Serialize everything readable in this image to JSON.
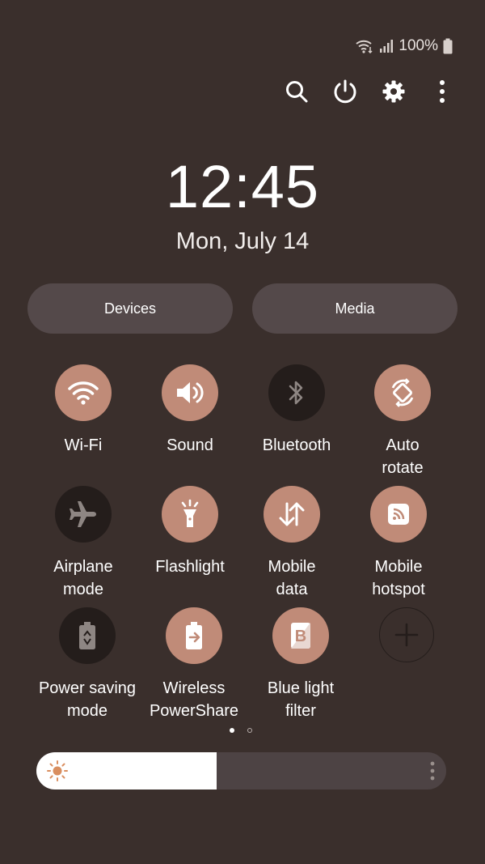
{
  "status": {
    "battery": "100%"
  },
  "clock": {
    "time": "12:45",
    "date": "Mon, July 14"
  },
  "pills": {
    "devices": "Devices",
    "media": "Media"
  },
  "tiles": [
    {
      "label": "Wi-Fi",
      "icon": "wifi-icon",
      "state": "on"
    },
    {
      "label": "Sound",
      "icon": "sound-icon",
      "state": "on"
    },
    {
      "label": "Bluetooth",
      "icon": "bluetooth-icon",
      "state": "off"
    },
    {
      "label": "Auto\nrotate",
      "icon": "auto-rotate-icon",
      "state": "on"
    },
    {
      "label": "Airplane\nmode",
      "icon": "airplane-icon",
      "state": "off"
    },
    {
      "label": "Flashlight",
      "icon": "flashlight-icon",
      "state": "on"
    },
    {
      "label": "Mobile\ndata",
      "icon": "mobile-data-icon",
      "state": "on"
    },
    {
      "label": "Mobile\nhotspot",
      "icon": "hotspot-icon",
      "state": "on"
    },
    {
      "label": "Power saving\nmode",
      "icon": "power-saving-icon",
      "state": "off"
    },
    {
      "label": "Wireless\nPowerShare",
      "icon": "wireless-powershare-icon",
      "state": "on"
    },
    {
      "label": "Blue light\nfilter",
      "icon": "blue-light-filter-icon",
      "state": "on"
    },
    {
      "label": "",
      "icon": "add-icon",
      "state": "add"
    }
  ],
  "page_indicator": {
    "current": 1,
    "total": 2
  },
  "brightness": {
    "level": 0.44
  },
  "colors": {
    "background": "#3a2f2c",
    "accent": "#c08b78",
    "off": "#241d1b",
    "pill": "#54494a"
  }
}
